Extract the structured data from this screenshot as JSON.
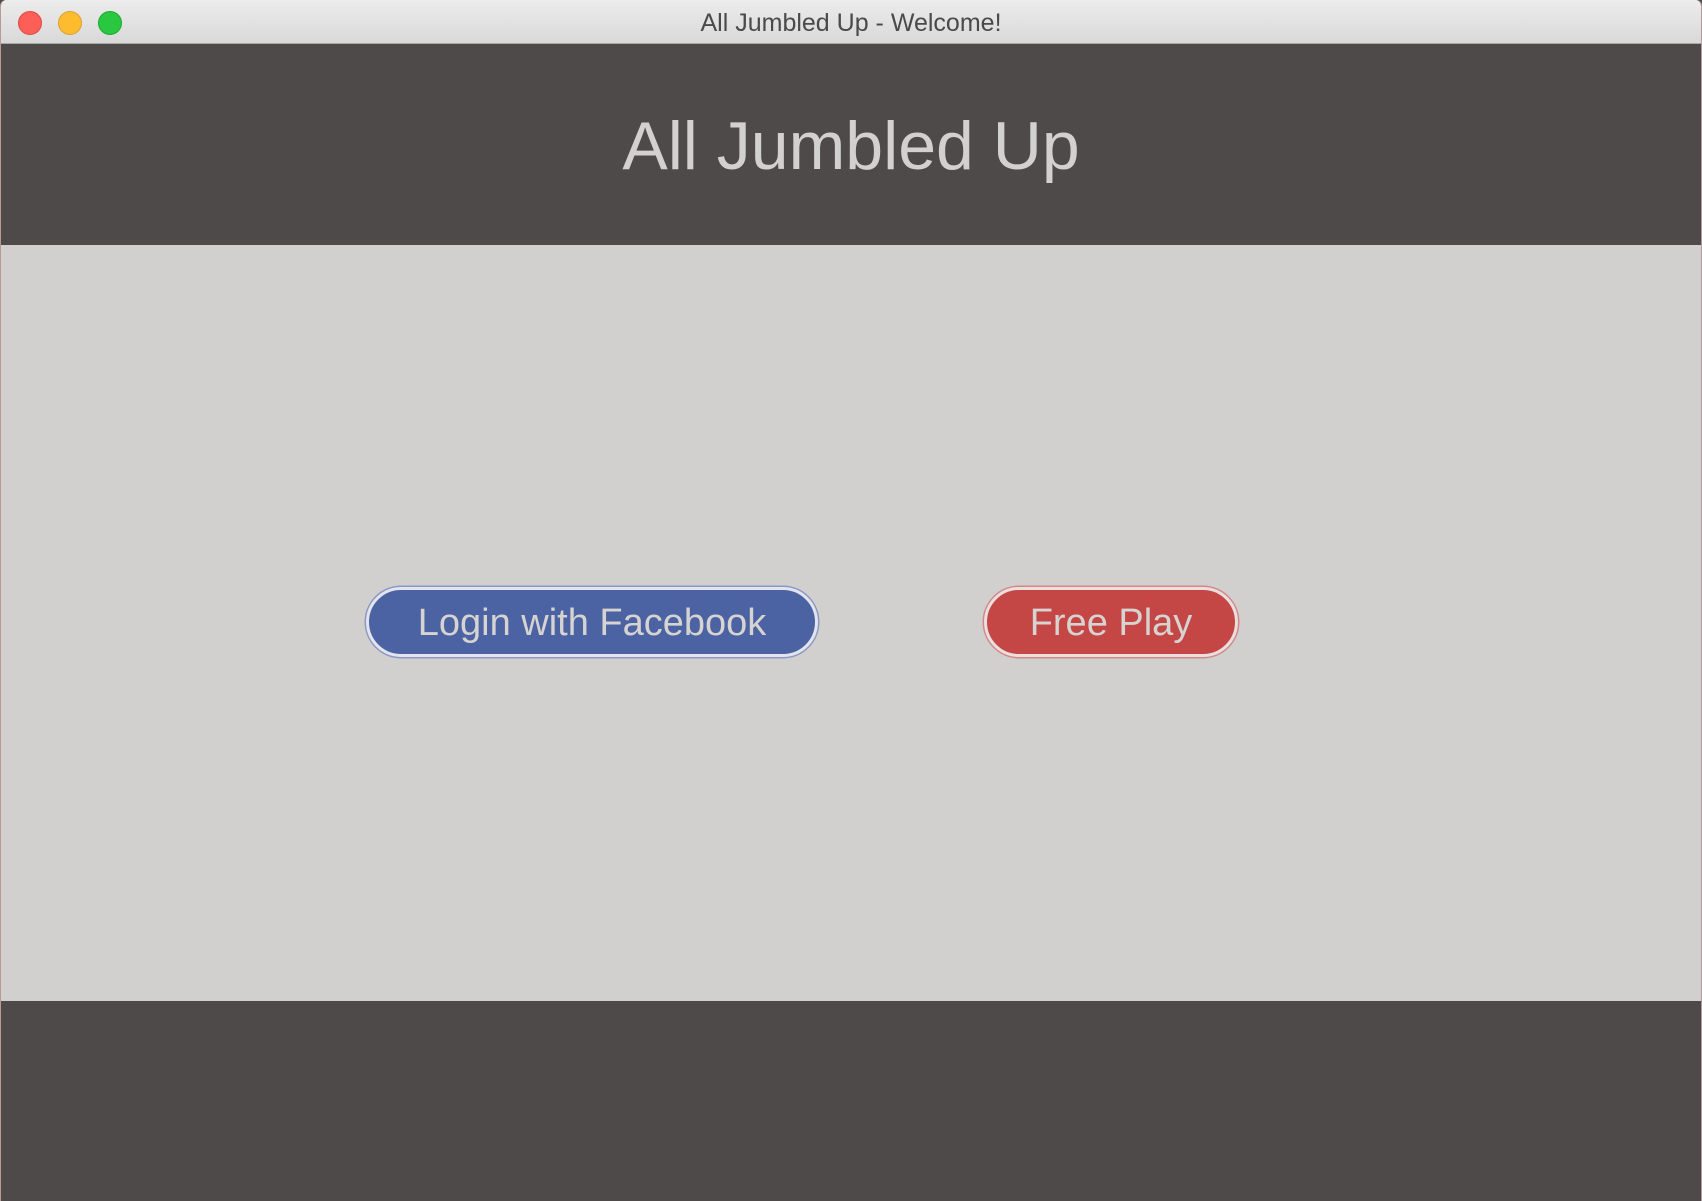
{
  "window": {
    "title": "All Jumbled Up - Welcome!"
  },
  "header": {
    "app_title": "All Jumbled Up"
  },
  "actions": {
    "facebook_login_label": "Login with Facebook",
    "free_play_label": "Free Play"
  },
  "colors": {
    "header_bg": "#4f4a4a",
    "content_bg": "#d2d0ce",
    "facebook_button": "#4b63a2",
    "free_play_button": "#c44746",
    "text_light": "#d3d1cf"
  },
  "icons": {
    "close": "close-icon",
    "minimize": "minimize-icon",
    "zoom": "zoom-icon"
  }
}
